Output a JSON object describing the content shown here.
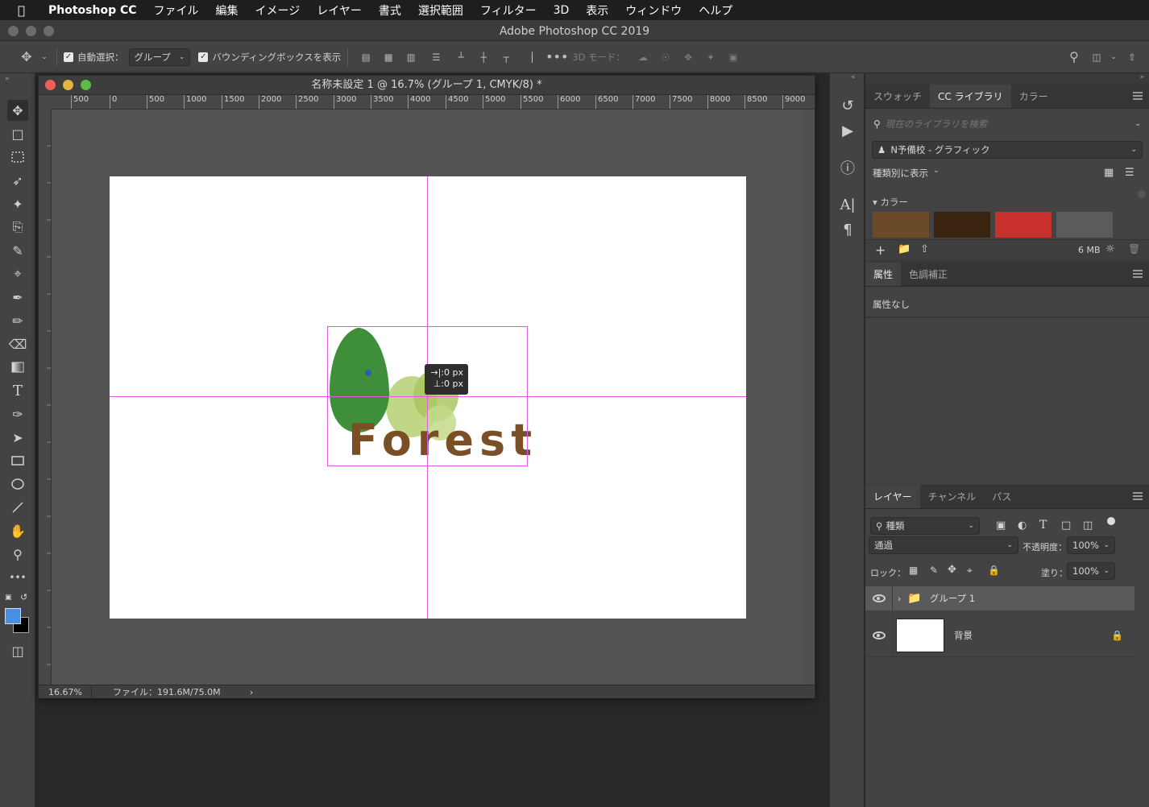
{
  "menubar": {
    "app_name": "Photoshop CC",
    "items": [
      "ファイル",
      "編集",
      "イメージ",
      "レイヤー",
      "書式",
      "選択範囲",
      "フィルター",
      "3D",
      "表示",
      "ウィンドウ",
      "ヘルプ"
    ]
  },
  "app_title": "Adobe Photoshop CC 2019",
  "options": {
    "auto_select_label": "自動選択：",
    "auto_select_value": "グループ",
    "bounding_box_label": "バウンディングボックスを表示",
    "mode_3d_label": "3D モード："
  },
  "document": {
    "title": "名称未設定 1 @ 16.7% (グループ 1, CMYK/8) *",
    "ruler_ticks": [
      "500",
      "0",
      "500",
      "1000",
      "1500",
      "2000",
      "2500",
      "3000",
      "3500",
      "4000",
      "4500",
      "5000",
      "5500",
      "6000",
      "6500",
      "7000",
      "7500",
      "8000",
      "8500",
      "9000"
    ],
    "artwork_text": "Forest",
    "tooltip_x": "→|:0 px",
    "tooltip_y": "⊥:0 px",
    "zoom": "16.67%",
    "file_info": "ファイル：191.6M/75.0M"
  },
  "library_panel": {
    "tabs": [
      "スウォッチ",
      "CC ライブラリ",
      "カラー"
    ],
    "active_tab": 1,
    "search_placeholder": "現在のライブラリを検索",
    "library_name": "N予備校 - グラフィック",
    "view_by": "種類別に表示",
    "section_colors": "カラー",
    "swatches": [
      "#6a4a28",
      "#3a2410",
      "#c8302e",
      "#5b5b5b"
    ],
    "storage": "6 MB"
  },
  "properties_panel": {
    "tabs": [
      "属性",
      "色調補正"
    ],
    "empty_text": "属性なし"
  },
  "layers_panel": {
    "tabs": [
      "レイヤー",
      "チャンネル",
      "パス"
    ],
    "filter_kind": "種類",
    "blend_mode": "通過",
    "opacity_label": "不透明度：",
    "opacity_value": "100%",
    "lock_label": "ロック：",
    "fill_label": "塗り：",
    "fill_value": "100%",
    "layers": [
      {
        "name": "グループ 1",
        "type": "group"
      },
      {
        "name": "背景",
        "type": "background"
      }
    ]
  },
  "colors": {
    "foreground": "#4a90e2",
    "background": "#000000",
    "guide": "#e05ce0",
    "accent_green": "#3f8f3a",
    "light_green": "#b9d37a",
    "brown": "#7a4f26"
  }
}
